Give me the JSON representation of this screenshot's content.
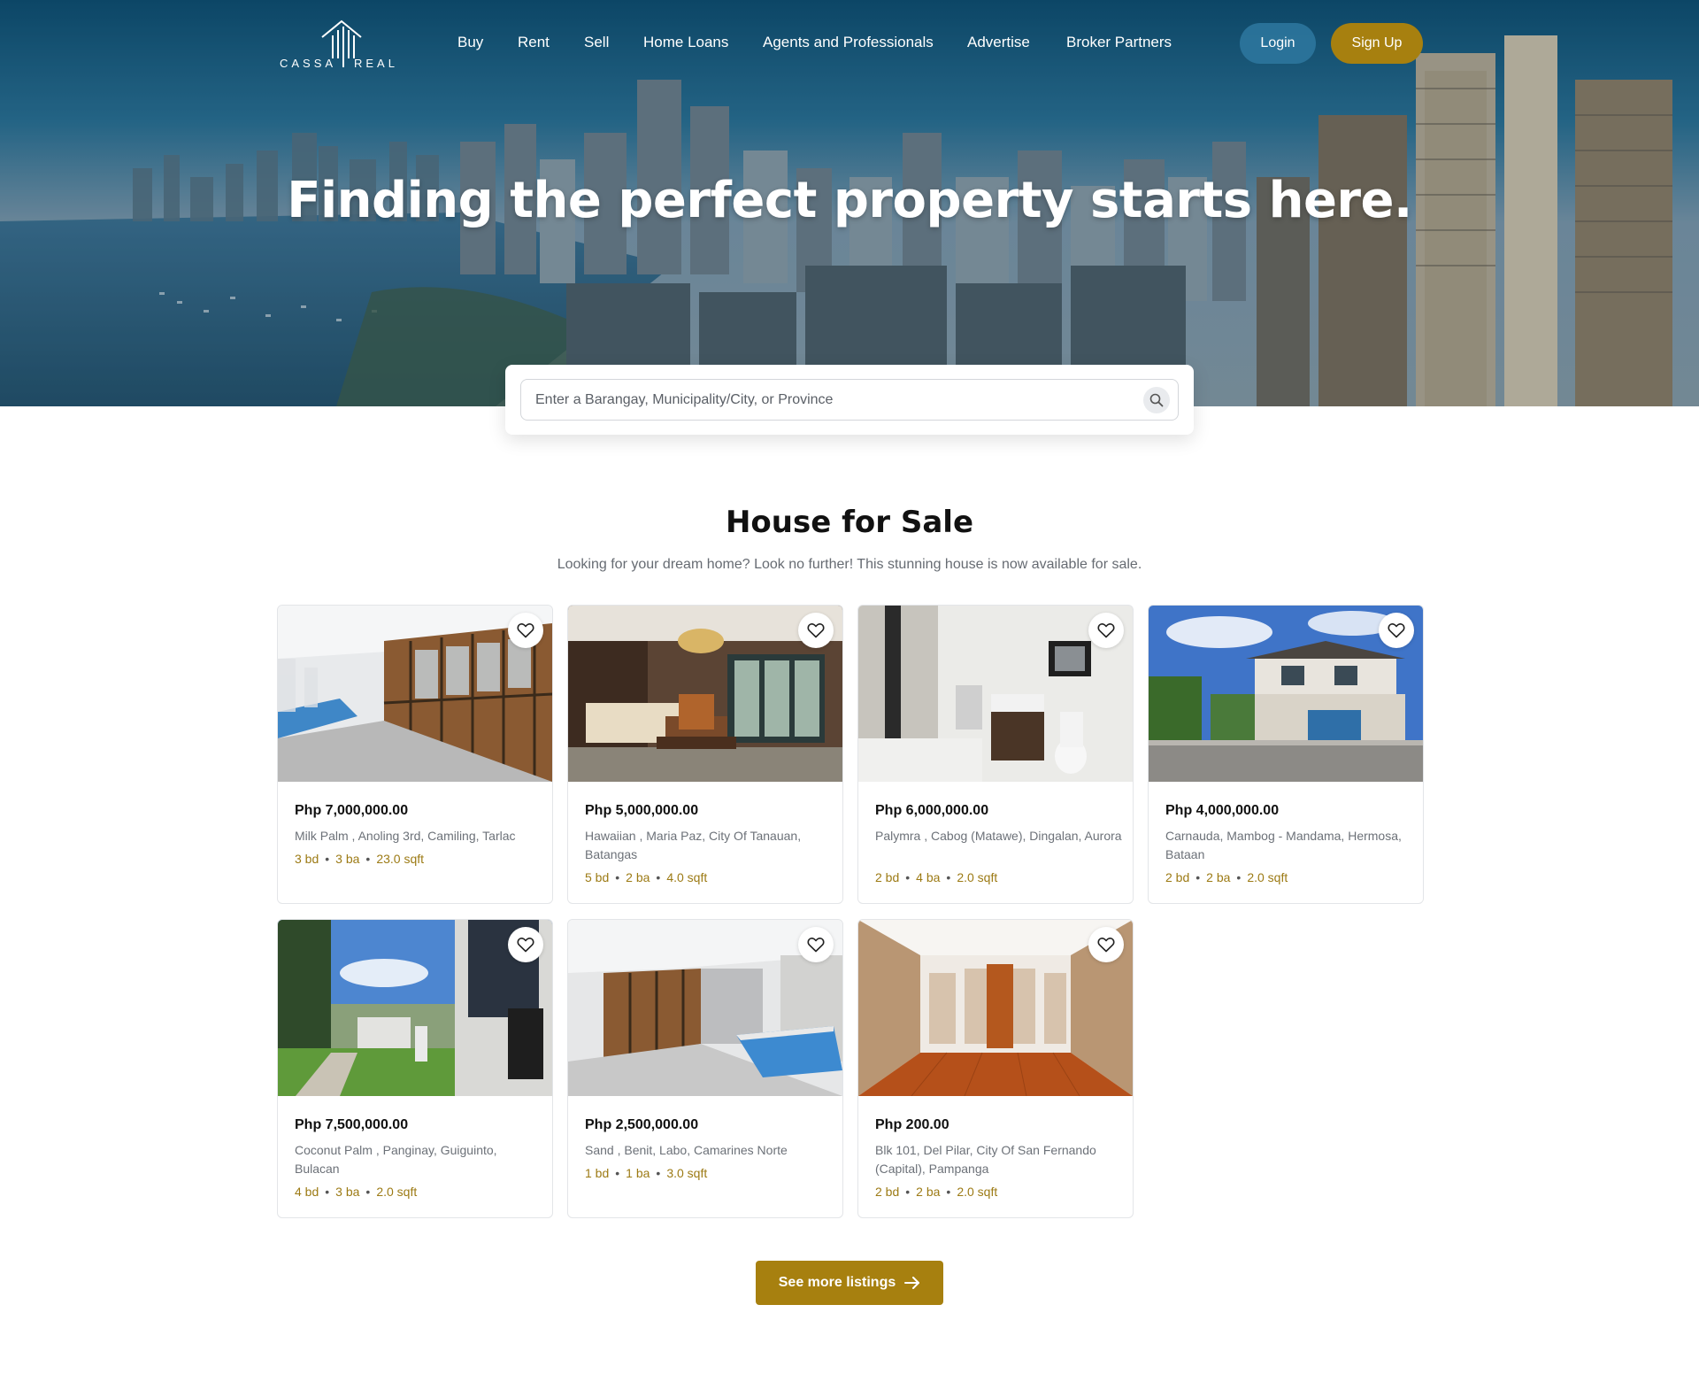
{
  "brand": {
    "left": "CASSA",
    "right": "REAL"
  },
  "nav": {
    "links": [
      "Buy",
      "Rent",
      "Sell",
      "Home Loans",
      "Agents and Professionals",
      "Advertise",
      "Broker Partners"
    ],
    "login_label": "Login",
    "signup_label": "Sign Up"
  },
  "hero": {
    "title": "Finding the perfect property starts here."
  },
  "search": {
    "placeholder": "Enter a Barangay, Municipality/City, or Province",
    "value": ""
  },
  "section": {
    "title": "House for Sale",
    "subtitle": "Looking for your dream home? Look no further! This stunning house is now available for sale."
  },
  "listings": [
    {
      "price": "Php 7,000,000.00",
      "address": "Milk Palm , Anoling 3rd, Camiling, Tarlac",
      "bd": "3 bd",
      "ba": "3 ba",
      "sqft": "23.0 sqft",
      "photo": "pool-corridor"
    },
    {
      "price": "Php 5,000,000.00",
      "address": "Hawaiian , Maria Paz, City Of Tanauan, Batangas",
      "bd": "5 bd",
      "ba": "2 ba",
      "sqft": "4.0 sqft",
      "photo": "living-room"
    },
    {
      "price": "Php 6,000,000.00",
      "address": "Palymra , Cabog (Matawe), Dingalan, Aurora",
      "bd": "2 bd",
      "ba": "4 ba",
      "sqft": "2.0 sqft",
      "photo": "bathroom"
    },
    {
      "price": "Php 4,000,000.00",
      "address": "Carnauda, Mambog - Mandama, Hermosa, Bataan",
      "bd": "2 bd",
      "ba": "2 ba",
      "sqft": "2.0 sqft",
      "photo": "house-exterior"
    },
    {
      "price": "Php 7,500,000.00",
      "address": "Coconut Palm , Panginay, Guiguinto, Bulacan",
      "bd": "4 bd",
      "ba": "3 ba",
      "sqft": "2.0 sqft",
      "photo": "garden"
    },
    {
      "price": "Php 2,500,000.00",
      "address": "Sand , Benit, Labo, Camarines Norte",
      "bd": "1 bd",
      "ba": "1 ba",
      "sqft": "3.0 sqft",
      "photo": "pool-room"
    },
    {
      "price": "Php 200.00",
      "address": "Blk 101, Del Pilar, City Of San Fernando (Capital), Pampanga",
      "bd": "2 bd",
      "ba": "2 ba",
      "sqft": "2.0 sqft",
      "photo": "wood-hallway"
    }
  ],
  "cta": {
    "label": "See more listings"
  },
  "colors": {
    "accent": "#a7800f",
    "login_bg": "#2e78a0",
    "spec_text": "#9c7a14"
  },
  "icons": {
    "search": "search-icon",
    "favorite": "heart-icon",
    "arrow": "arrow-right-icon"
  }
}
